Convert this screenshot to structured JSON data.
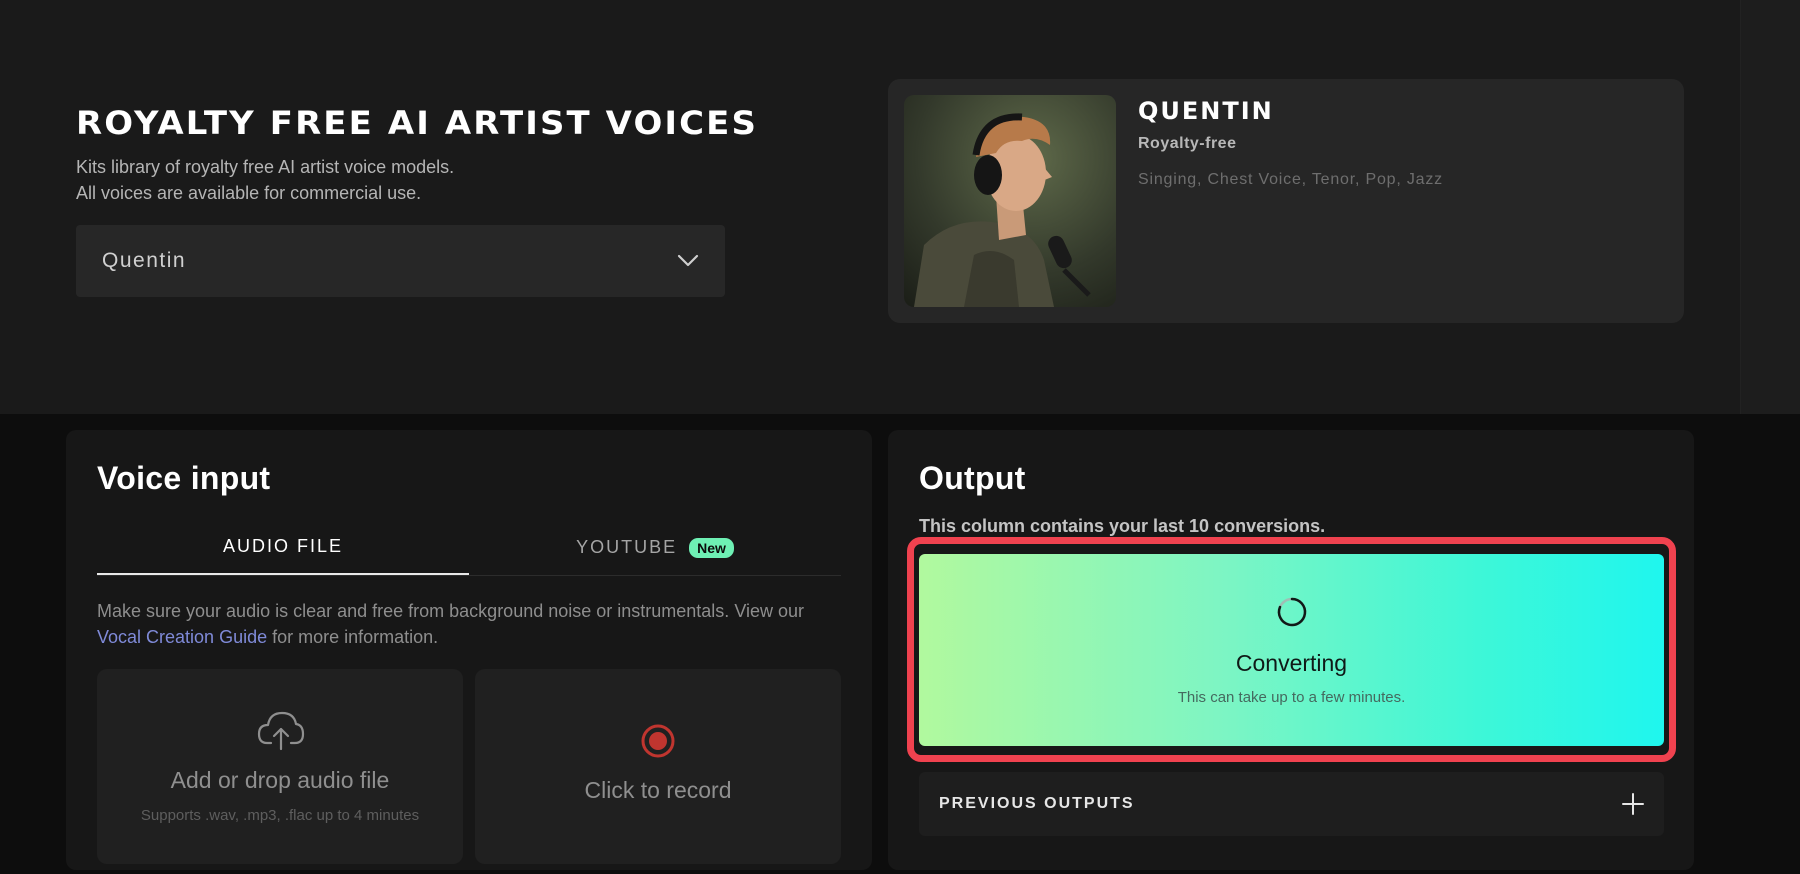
{
  "hero": {
    "title": "ROYALTY FREE AI ARTIST VOICES",
    "description_line1": "Kits library of royalty free AI artist voice models.",
    "description_line2": "All voices are available for commercial use.",
    "voice_select": {
      "value": "Quentin"
    }
  },
  "voice_card": {
    "name": "QUENTIN",
    "license": "Royalty-free",
    "tags": "Singing, Chest Voice, Tenor, Pop, Jazz"
  },
  "voice_input": {
    "title": "Voice input",
    "tabs": [
      {
        "label": "AUDIO FILE",
        "active": true
      },
      {
        "label": "YOUTUBE",
        "badge": "New",
        "active": false
      }
    ],
    "description_pre": "Make sure your audio is clear and free from background noise or instrumentals. View our ",
    "description_link": "Vocal Creation Guide",
    "description_post": " for more information.",
    "upload": {
      "title": "Add or drop audio file",
      "subtitle": "Supports .wav, .mp3, .flac up to 4 minutes"
    },
    "record": {
      "title": "Click to record"
    }
  },
  "output": {
    "title": "Output",
    "description": "This column contains your last 10 conversions.",
    "status": {
      "title": "Converting",
      "subtitle": "This can take up to a few minutes."
    },
    "previous_outputs_label": "PREVIOUS OUTPUTS"
  },
  "colors": {
    "accent_red": "#f0424f",
    "gradient_start": "#b1f99e",
    "gradient_end": "#1ff6ee",
    "badge_green": "#6ef0b4",
    "link_blue": "#7f8ad8",
    "record_red": "#c0352f"
  },
  "icons": {
    "select": "chevron-down-icon",
    "upload": "cloud-upload-icon",
    "record": "record-icon",
    "converting": "spinner-icon",
    "previous_outputs": "plus-icon"
  }
}
